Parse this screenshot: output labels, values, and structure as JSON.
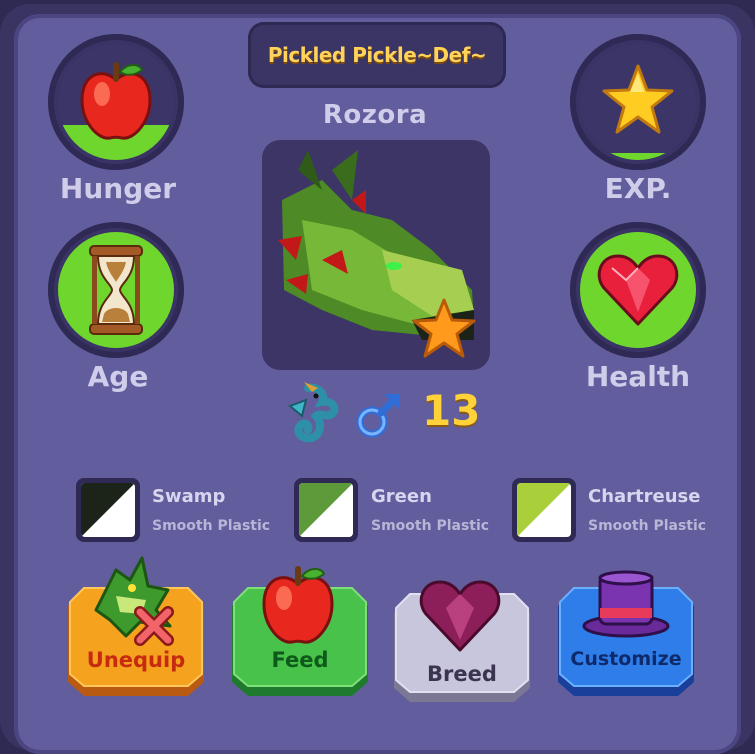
{
  "header": {
    "title": "Pickled Pickle~Def~"
  },
  "pet": {
    "name": "Rozora",
    "age": "13"
  },
  "stats": {
    "hunger": {
      "label": "Hunger",
      "level": 0.3,
      "icon": "apple-icon"
    },
    "exp": {
      "label": "EXP.",
      "level": 0.06,
      "icon": "star-icon"
    },
    "age": {
      "label": "Age",
      "level": 1.0,
      "icon": "hourglass-icon"
    },
    "health": {
      "label": "Health",
      "level": 1.0,
      "icon": "heart-icon"
    }
  },
  "colors": [
    {
      "name": "Swamp",
      "material": "Smooth Plastic",
      "swatch": "#1c2419"
    },
    {
      "name": "Green",
      "material": "Smooth Plastic",
      "swatch": "#5d9a3a"
    },
    {
      "name": "Chartreuse",
      "material": "Smooth Plastic",
      "swatch": "#a9cf3a"
    }
  ],
  "actions": {
    "unequip": "Unequip",
    "feed": "Feed",
    "breed": "Breed",
    "customize": "Customize"
  },
  "theme": {
    "accent_green": "#6fd62e",
    "title_gold": "#ffd35a",
    "panel": "#625d9c"
  }
}
